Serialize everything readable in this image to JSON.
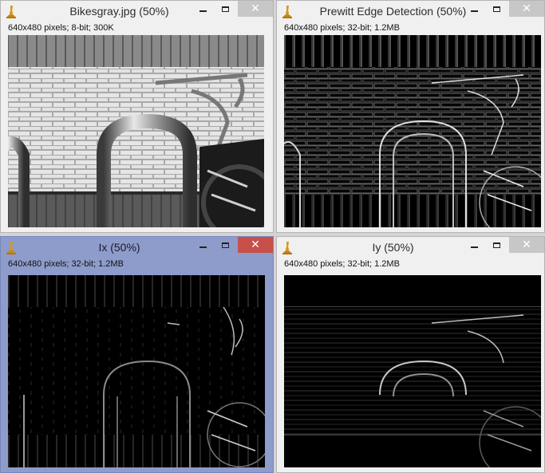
{
  "windows": [
    {
      "title": "Bikesgray.jpg (50%)",
      "info": "640x480 pixels; 8-bit; 300K"
    },
    {
      "title": "Prewitt Edge Detection (50%)",
      "info": "640x480 pixels; 32-bit; 1.2MB"
    },
    {
      "title": "Ix (50%)",
      "info": "640x480 pixels; 32-bit; 1.2MB"
    },
    {
      "title": "Iy (50%)",
      "info": "640x480 pixels; 32-bit; 1.2MB"
    }
  ],
  "active_window": "Ix (50%)",
  "colors": {
    "active_titlebar": "#8e9ccb",
    "close_active": "#c9504a",
    "inactive_titlebar": "#f0f0f0"
  },
  "icons": [
    "imagej-microscope-icon",
    "minimize-icon",
    "maximize-icon",
    "close-icon"
  ],
  "close_glyph": "✕"
}
